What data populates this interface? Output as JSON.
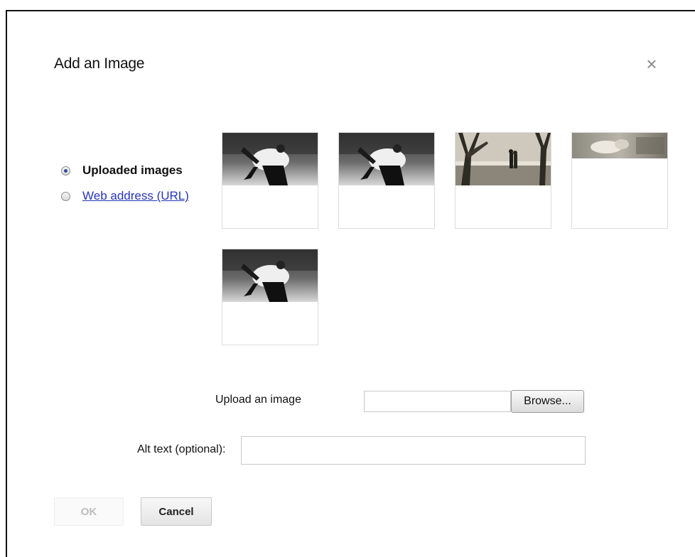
{
  "dialog": {
    "title": "Add an Image",
    "close_icon": "close-icon"
  },
  "sources": [
    {
      "label": "Uploaded images",
      "selected": true
    },
    {
      "label": "Web address (URL)",
      "selected": false
    }
  ],
  "thumbnails": [
    {
      "kind": "couple-dance"
    },
    {
      "kind": "couple-dance"
    },
    {
      "kind": "couple-tree"
    },
    {
      "kind": "couple-faded"
    },
    {
      "kind": "couple-dance"
    }
  ],
  "upload": {
    "label": "Upload an image",
    "file_value": "",
    "browse_label": "Browse..."
  },
  "alt": {
    "label": "Alt text (optional):",
    "value": ""
  },
  "buttons": {
    "ok_label": "OK",
    "cancel_label": "Cancel"
  },
  "colors": {
    "link": "#2535b8",
    "radio_selected": "#2a4f9a",
    "ok_disabled_text": "#bcbcbc"
  }
}
